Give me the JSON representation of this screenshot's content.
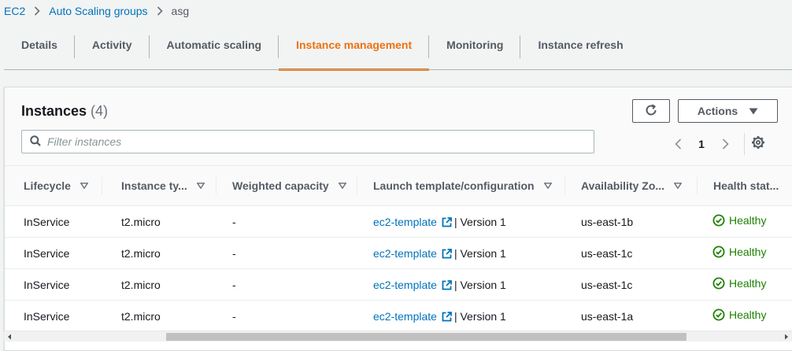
{
  "breadcrumb": {
    "items": [
      "EC2",
      "Auto Scaling groups"
    ],
    "current": "asg"
  },
  "tabs": [
    {
      "label": "Details"
    },
    {
      "label": "Activity"
    },
    {
      "label": "Automatic scaling"
    },
    {
      "label": "Instance management",
      "active": true
    },
    {
      "label": "Monitoring"
    },
    {
      "label": "Instance refresh"
    }
  ],
  "instances": {
    "title": "Instances",
    "count": "(4)",
    "actions_label": "Actions",
    "filter_placeholder": "Filter instances",
    "page": "1",
    "columns": [
      "Lifecycle",
      "Instance ty...",
      "Weighted capacity",
      "Launch template/configuration",
      "Availability Zo...",
      "Health stat..."
    ],
    "rows": [
      {
        "lifecycle": "InService",
        "type": "t2.micro",
        "weight": "-",
        "template": "ec2-template",
        "version": "| Version 1",
        "az": "us-east-1b",
        "health": "Healthy"
      },
      {
        "lifecycle": "InService",
        "type": "t2.micro",
        "weight": "-",
        "template": "ec2-template",
        "version": "| Version 1",
        "az": "us-east-1c",
        "health": "Healthy"
      },
      {
        "lifecycle": "InService",
        "type": "t2.micro",
        "weight": "-",
        "template": "ec2-template",
        "version": "| Version 1",
        "az": "us-east-1c",
        "health": "Healthy"
      },
      {
        "lifecycle": "InService",
        "type": "t2.micro",
        "weight": "-",
        "template": "ec2-template",
        "version": "| Version 1",
        "az": "us-east-1a",
        "health": "Healthy"
      }
    ]
  },
  "colors": {
    "link": "#0073bb",
    "active_tab": "#ec7211",
    "healthy": "#1d8102"
  }
}
